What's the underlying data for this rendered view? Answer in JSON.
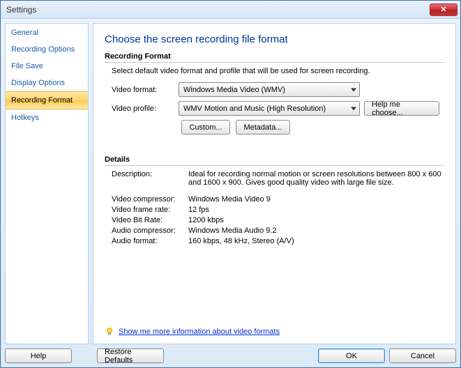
{
  "window": {
    "title": "Settings",
    "close_glyph": "✕"
  },
  "sidebar": {
    "items": [
      {
        "label": "General"
      },
      {
        "label": "Recording Options"
      },
      {
        "label": "File Save"
      },
      {
        "label": "Display Options"
      },
      {
        "label": "Recording Format"
      },
      {
        "label": "Hotkeys"
      }
    ],
    "selected_index": 4
  },
  "page": {
    "title": "Choose the screen recording file format",
    "format_group": {
      "heading": "Recording Format",
      "description": "Select default video format and profile that will be used for screen recording.",
      "video_format_label": "Video format:",
      "video_format_value": "Windows Media Video (WMV)",
      "video_profile_label": "Video profile:",
      "video_profile_value": "WMV Motion and Music (High Resolution)",
      "help_choose": "Help me choose...",
      "custom_btn": "Custom...",
      "metadata_btn": "Metadata..."
    },
    "details_group": {
      "heading": "Details",
      "rows": [
        {
          "k": "Description:",
          "v": "Ideal for recording normal motion or screen resolutions between 800 x 600 and 1600 x 900. Gives good quality video with large file size."
        },
        {
          "k": "Video compressor:",
          "v": "Windows Media Video 9"
        },
        {
          "k": "Video frame rate:",
          "v": "12 fps"
        },
        {
          "k": "Video Bit Rate:",
          "v": "1200 kbps"
        },
        {
          "k": "Audio compressor:",
          "v": "Windows Media Audio 9.2"
        },
        {
          "k": "Audio format:",
          "v": "160 kbps, 48 kHz, Stereo (A/V)"
        }
      ]
    },
    "info_link": "Show me more information about video formats"
  },
  "buttons": {
    "help": "Help",
    "restore": "Restore Defaults",
    "ok": "OK",
    "cancel": "Cancel"
  }
}
